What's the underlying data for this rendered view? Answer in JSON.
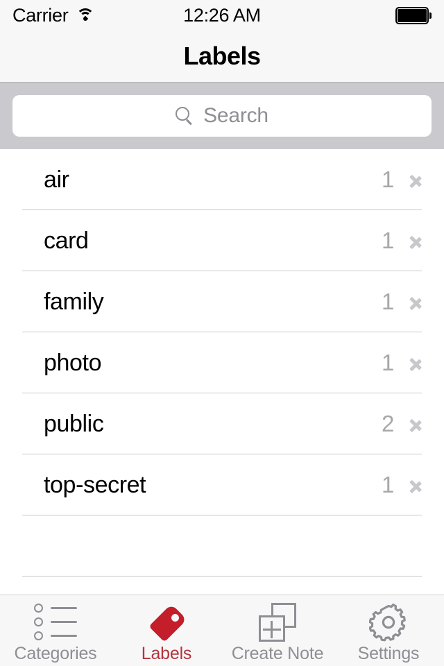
{
  "statusbar": {
    "carrier": "Carrier",
    "wifi_icon": "wifi-icon",
    "time": "12:26 AM",
    "battery_icon": "battery-icon"
  },
  "navbar": {
    "title": "Labels"
  },
  "search": {
    "icon": "search-icon",
    "placeholder": "Search",
    "value": ""
  },
  "list": {
    "rows": [
      {
        "label": "air",
        "count": "1",
        "chevron": "chevron-right-icon"
      },
      {
        "label": "card",
        "count": "1",
        "chevron": "chevron-right-icon"
      },
      {
        "label": "family",
        "count": "1",
        "chevron": "chevron-right-icon"
      },
      {
        "label": "photo",
        "count": "1",
        "chevron": "chevron-right-icon"
      },
      {
        "label": "public",
        "count": "2",
        "chevron": "chevron-right-icon"
      },
      {
        "label": "top-secret",
        "count": "1",
        "chevron": "chevron-right-icon"
      }
    ]
  },
  "tabbar": {
    "tabs": [
      {
        "label": "Categories",
        "icon": "list-bullet-icon",
        "active": false
      },
      {
        "label": "Labels",
        "icon": "tag-icon",
        "active": true
      },
      {
        "label": "Create Note",
        "icon": "new-note-icon",
        "active": false
      },
      {
        "label": "Settings",
        "icon": "gear-icon",
        "active": false
      }
    ]
  },
  "colors": {
    "accent_red": "#C41E2A",
    "accent_red_text": "#B5323C",
    "inactive_gray": "#8E8E93",
    "separator": "#C8C7CC",
    "chrome_bg": "#F7F7F8",
    "searchbar_bg": "#C9C9CE"
  }
}
